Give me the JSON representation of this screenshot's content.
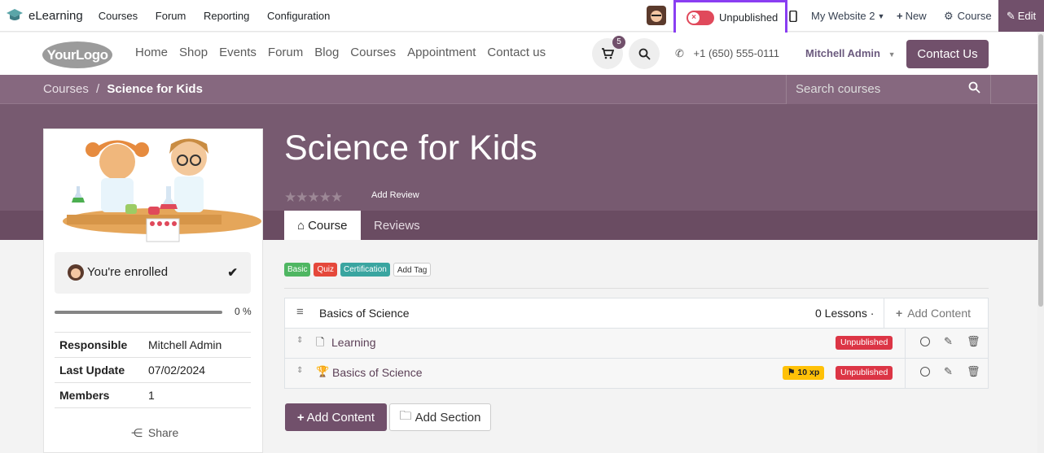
{
  "admin_bar": {
    "app_name": "eLearning",
    "menu": [
      "Courses",
      "Forum",
      "Reporting",
      "Configuration"
    ],
    "publish_status": "Unpublished",
    "website": "My Website 2",
    "new_label": "New",
    "course_label": "Course",
    "edit_label": "Edit"
  },
  "site_header": {
    "logo_text": "YourLogo",
    "nav": [
      "Home",
      "Shop",
      "Events",
      "Forum",
      "Blog",
      "Courses",
      "Appointment",
      "Contact us"
    ],
    "cart_count": "5",
    "phone": "+1 (650) 555-0111",
    "user": "Mitchell Admin",
    "contact_button": "Contact Us"
  },
  "breadcrumb": {
    "parent": "Courses",
    "separator": "/",
    "current": "Science for Kids"
  },
  "search": {
    "placeholder": "Search courses"
  },
  "course": {
    "title": "Science for Kids",
    "add_review": "Add Review",
    "tabs": [
      "Course",
      "Reviews"
    ],
    "tags": [
      {
        "label": "Basic",
        "color": "#4fb662"
      },
      {
        "label": "Quiz",
        "color": "#e5483b"
      },
      {
        "label": "Certification",
        "color": "#3aa5a0"
      }
    ],
    "add_tag": "Add Tag"
  },
  "sidebar": {
    "enrolled_text": "You're enrolled",
    "progress_label": "0 %",
    "progress_value": 0,
    "info": [
      {
        "key": "Responsible",
        "value": "Mitchell Admin"
      },
      {
        "key": "Last Update",
        "value": "07/02/2024"
      },
      {
        "key": "Members",
        "value": "1"
      }
    ],
    "share_label": "Share"
  },
  "content": {
    "section": {
      "title": "Basics of Science",
      "lessons": "0 Lessons ·",
      "add_content": "Add Content"
    },
    "lessons": [
      {
        "title": "Learning",
        "status": "Unpublished",
        "icon": "document-icon"
      },
      {
        "title": "Basics of Science",
        "status": "Unpublished",
        "xp": "10 xp",
        "icon": "trophy-icon"
      }
    ],
    "add_content_button": "Add Content",
    "add_section_button": "Add Section"
  },
  "colors": {
    "brand": "#71506b",
    "danger": "#dc3545",
    "warning": "#ffc107",
    "focus_outline": "#8a3ef2"
  }
}
